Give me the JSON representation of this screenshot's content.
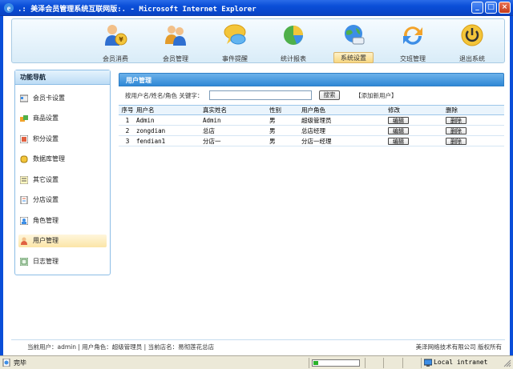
{
  "window": {
    "title": ".: 美泽会员管理系统互联网版:. - Microsoft Internet Explorer",
    "minimize_label": "_",
    "maximize_label": "□",
    "close_label": "×"
  },
  "topnav": {
    "items": [
      {
        "label": "会员消费",
        "icon": "member-consume-icon"
      },
      {
        "label": "会员管理",
        "icon": "member-manage-icon"
      },
      {
        "label": "事件提醒",
        "icon": "event-reminder-icon"
      },
      {
        "label": "统计报表",
        "icon": "statistics-report-icon"
      },
      {
        "label": "系统设置",
        "icon": "system-settings-icon",
        "active": true
      },
      {
        "label": "交班管理",
        "icon": "shift-handover-icon"
      },
      {
        "label": "退出系统",
        "icon": "power-exit-icon"
      }
    ]
  },
  "sidebar": {
    "title": "功能导航",
    "items": [
      {
        "label": "会员卡设置",
        "icon": "member-card-icon"
      },
      {
        "label": "商品设置",
        "icon": "goods-icon"
      },
      {
        "label": "积分设置",
        "icon": "points-icon"
      },
      {
        "label": "数据库管理",
        "icon": "database-icon"
      },
      {
        "label": "其它设置",
        "icon": "other-settings-icon"
      },
      {
        "label": "分店设置",
        "icon": "branch-icon"
      },
      {
        "label": "角色管理",
        "icon": "role-icon"
      },
      {
        "label": "用户管理",
        "icon": "user-icon",
        "active": true
      },
      {
        "label": "日志管理",
        "icon": "log-icon"
      }
    ]
  },
  "panel": {
    "title": "用户管理",
    "search_label": "按用户名/姓名/角色 关键字：",
    "search_value": "",
    "search_button": "搜索",
    "add_user_link": "【添加新用户】"
  },
  "table": {
    "headers": {
      "no": "序号",
      "username": "用户名",
      "realname": "真实姓名",
      "sex": "性别",
      "role": "用户角色",
      "edit": "修改",
      "delete": "删除"
    },
    "rows": [
      {
        "no": "1",
        "username": "Admin",
        "realname": "Admin",
        "sex": "男",
        "role": "超级管理员",
        "edit": "编辑",
        "delete": "删除"
      },
      {
        "no": "2",
        "username": "zongdian",
        "realname": "总店",
        "sex": "男",
        "role": "总店经理",
        "edit": "编辑",
        "delete": "删除"
      },
      {
        "no": "3",
        "username": "fendian1",
        "realname": "分店一",
        "sex": "男",
        "role": "分店一经理",
        "edit": "编辑",
        "delete": "删除"
      }
    ]
  },
  "footer": {
    "status_line": "当前用户：admin  | 用户角色：超级管理员  | 当前店名：易彻莲花总店",
    "copyright": "美泽网络技术有限公司 版权所有"
  },
  "statusbar": {
    "text": "完毕",
    "zone": "Local intranet",
    "progress": 0.1
  },
  "colors": {
    "titlebar": "#0a4ed8",
    "panel_header": "#2f88d6",
    "active_highlight": "#fbe5a7"
  }
}
